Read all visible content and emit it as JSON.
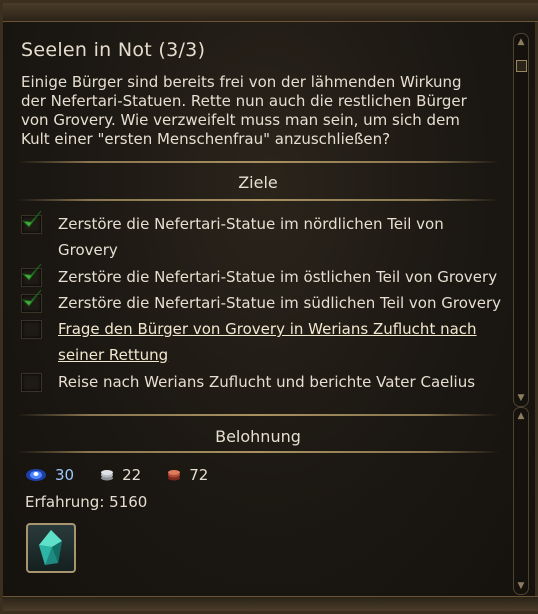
{
  "quest": {
    "title": "Seelen in Not (3/3)",
    "description": "Einige Bürger sind bereits frei von der lähmenden Wirkung der Nefertari-Statuen. Rette nun auch die restlichen Bürger von Grovery. Wie verzweifelt muss man sein, um sich dem Kult einer \"ersten Menschenfrau\" anzuschließen?"
  },
  "objectives": {
    "heading": "Ziele",
    "items": [
      {
        "line1": "Zerstöre die Nefertari-Statue im nördlichen Teil von",
        "line2": "Grovery",
        "done": true
      },
      {
        "line1": "Zerstöre die Nefertari-Statue im östlichen Teil von Grovery",
        "done": true
      },
      {
        "line1": "Zerstöre die Nefertari-Statue im südlichen Teil von Grovery",
        "done": true
      },
      {
        "line1": "Frage den Bürger von Grovery in Werians Zuflucht nach",
        "line2": "seiner Rettung",
        "done": false,
        "link": true
      },
      {
        "line1": "Reise nach Werians Zuflucht und berichte Vater Caelius",
        "done": false
      }
    ]
  },
  "rewards": {
    "heading": "Belohnung",
    "currencies": [
      {
        "icon": "blue-gem-icon",
        "value": "30",
        "color": "#9fc8ff"
      },
      {
        "icon": "silver-coin-icon",
        "value": "22",
        "color": "#e6dfd1"
      },
      {
        "icon": "copper-coin-icon",
        "value": "72",
        "color": "#e6dfd1"
      }
    ],
    "experience_label": "Erfahrung:",
    "experience_value": "5160",
    "item_icon": "green-crystal-icon"
  }
}
